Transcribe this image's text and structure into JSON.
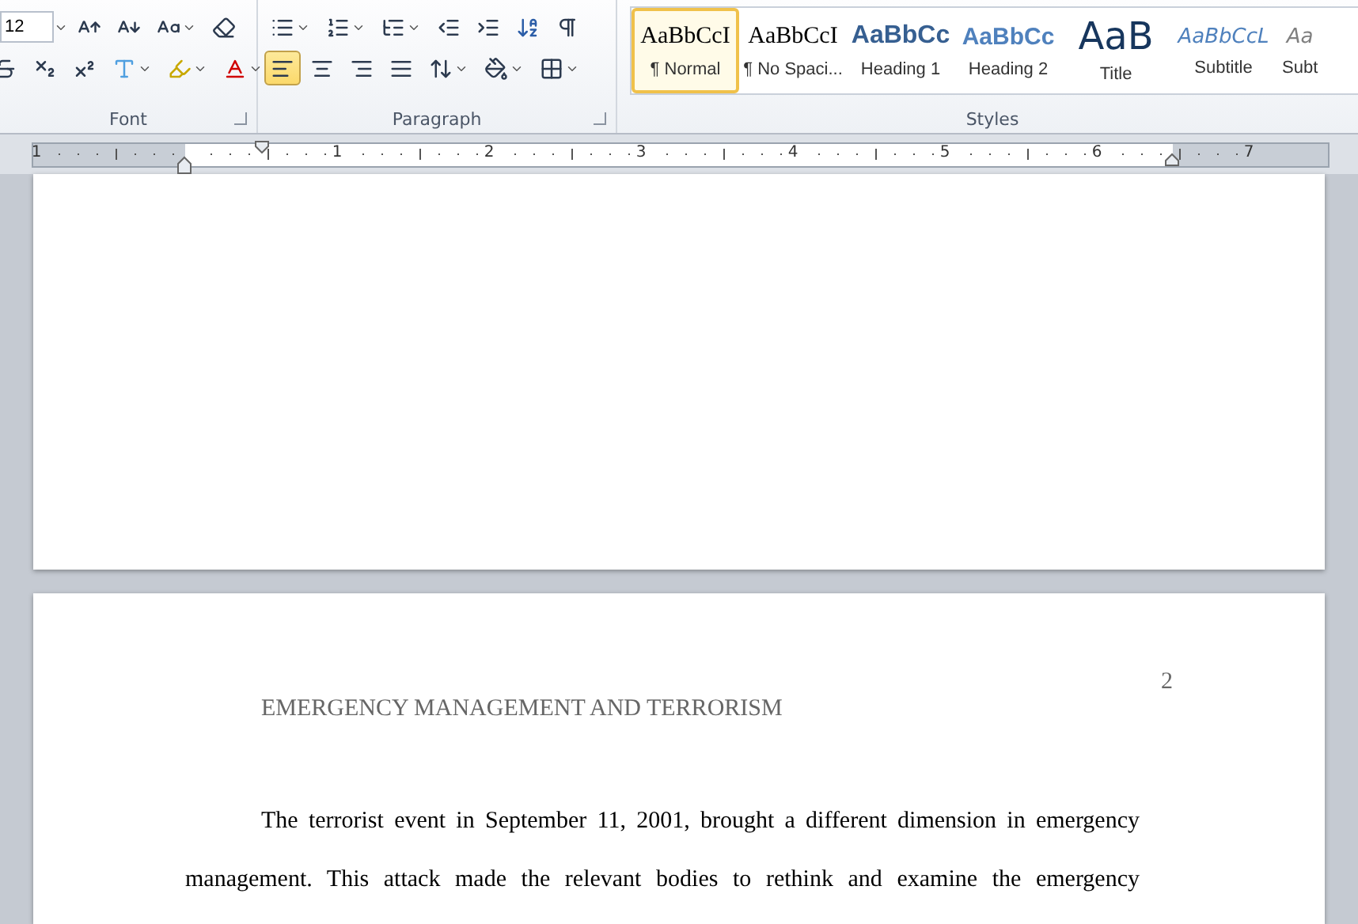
{
  "ribbon": {
    "font_group": {
      "label": "Font",
      "launcher": true,
      "size_field": {
        "value": "12"
      },
      "row1": [
        {
          "kind": "grow",
          "dropdown": false
        },
        {
          "kind": "shrink",
          "dropdown": false
        },
        {
          "kind": "case",
          "dropdown": true
        },
        {
          "kind": "clear",
          "dropdown": false
        }
      ],
      "row2": [
        {
          "kind": "strike",
          "dropdown": false
        },
        {
          "kind": "subscript",
          "dropdown": false
        },
        {
          "kind": "superscript",
          "dropdown": false
        },
        {
          "kind": "effects",
          "dropdown": true
        },
        {
          "kind": "highlight",
          "dropdown": true
        },
        {
          "kind": "fontcolor",
          "dropdown": true
        }
      ]
    },
    "paragraph_group": {
      "label": "Paragraph",
      "launcher": true,
      "row1": [
        {
          "kind": "bullets",
          "dropdown": true
        },
        {
          "kind": "numbering",
          "dropdown": true
        },
        {
          "kind": "multilevel",
          "dropdown": true
        },
        {
          "kind": "outdent",
          "dropdown": false
        },
        {
          "kind": "indent",
          "dropdown": false
        },
        {
          "kind": "sort",
          "dropdown": false
        },
        {
          "kind": "pilcrow",
          "dropdown": false
        }
      ],
      "row2": [
        {
          "kind": "left",
          "dropdown": false,
          "selected": true
        },
        {
          "kind": "center",
          "dropdown": false,
          "selected": false
        },
        {
          "kind": "right",
          "dropdown": false,
          "selected": false
        },
        {
          "kind": "justify",
          "dropdown": false,
          "selected": false
        },
        {
          "kind": "spacing",
          "dropdown": true,
          "selected": false
        },
        {
          "kind": "shading",
          "dropdown": true,
          "selected": false
        },
        {
          "kind": "borders",
          "dropdown": true,
          "selected": false
        }
      ]
    },
    "styles_group": {
      "label": "Styles",
      "styles": [
        {
          "kind": "normal",
          "sample": "AaBbCcI",
          "label": "¶ Normal",
          "selected": true
        },
        {
          "kind": "nospacing",
          "sample": "AaBbCcI",
          "label": "¶ No Spaci...",
          "selected": false
        },
        {
          "kind": "heading1",
          "sample": "AaBbCc",
          "label": "Heading 1",
          "selected": false
        },
        {
          "kind": "heading2",
          "sample": "AaBbCc",
          "label": "Heading 2",
          "selected": false
        },
        {
          "kind": "title",
          "sample": "AaB",
          "label": "Title",
          "selected": false
        },
        {
          "kind": "subtitle",
          "sample": "AaBbCcL",
          "label": "Subtitle",
          "selected": false
        },
        {
          "kind": "subtle",
          "sample": "Aa",
          "label": "Subt",
          "selected": false
        }
      ]
    }
  },
  "ruler": {
    "left_label": "1",
    "numbers": [
      "1",
      "2",
      "3",
      "4",
      "5",
      "6",
      "7"
    ]
  },
  "page_2": {
    "page_number": "2",
    "header": "EMERGENCY MANAGEMENT AND TERRORISM",
    "lines": [
      "The terrorist event in September 11, 2001, brought a different dimension in emergency",
      "management. This attack made the relevant bodies to rethink and examine the emergency"
    ]
  }
}
